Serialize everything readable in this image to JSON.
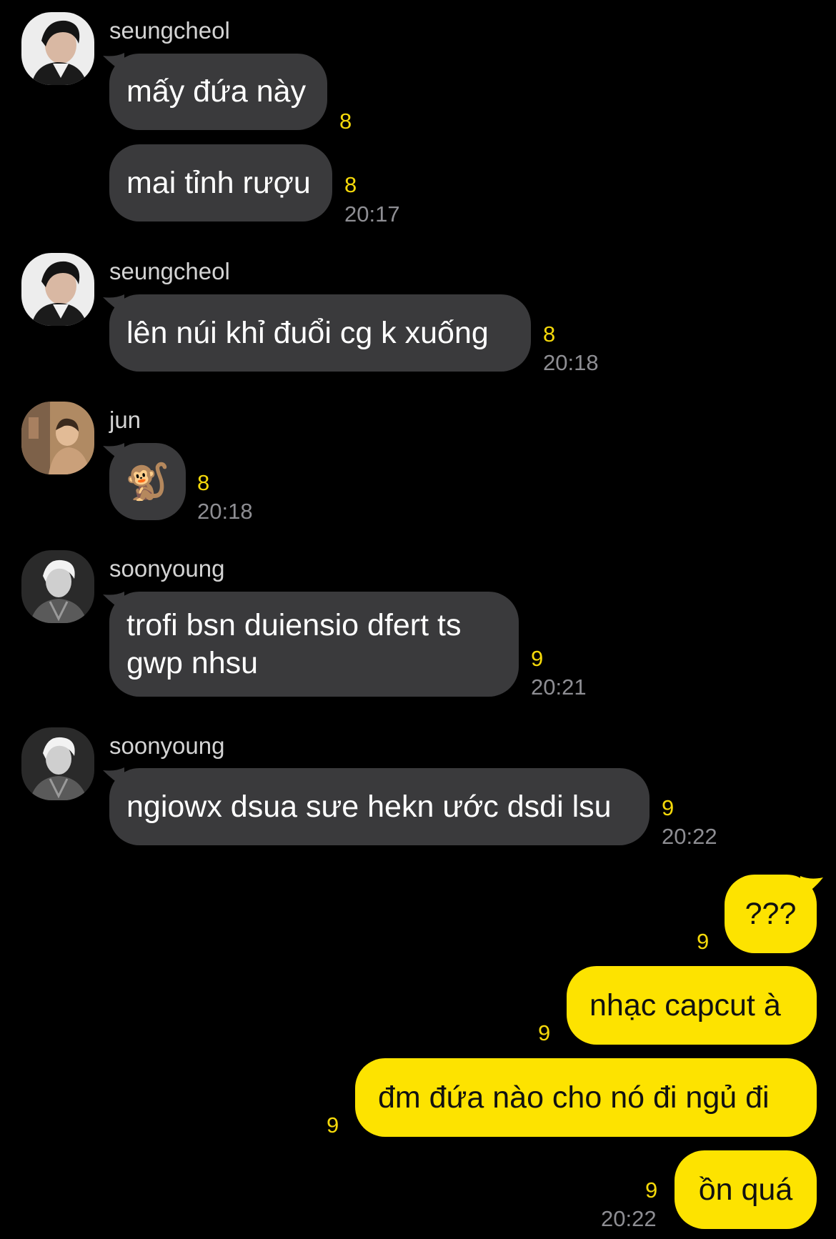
{
  "colors": {
    "background": "#000000",
    "incoming_bubble": "#3a3a3c",
    "outgoing_bubble": "#fde300",
    "unread_count": "#f5d90a",
    "timestamp": "#8e8e93"
  },
  "messages": [
    {
      "sender": "seungcheol",
      "bubbles": [
        {
          "text": "mấy đứa này",
          "unread": "8"
        },
        {
          "text": "mai tỉnh rượu",
          "unread": "8",
          "time": "20:17"
        }
      ]
    },
    {
      "sender": "seungcheol",
      "bubbles": [
        {
          "text": "lên núi khỉ đuổi cg k xuống",
          "unread": "8",
          "time": "20:18"
        }
      ]
    },
    {
      "sender": "jun",
      "bubbles": [
        {
          "text": "🐒",
          "unread": "8",
          "time": "20:18"
        }
      ]
    },
    {
      "sender": "soonyoung",
      "bubbles": [
        {
          "text": "trofi bsn duiensio dfert ts gwp nhsu",
          "unread": "9",
          "time": "20:21"
        }
      ]
    },
    {
      "sender": "soonyoung",
      "bubbles": [
        {
          "text": "ngiowx dsua sưe hekn ước dsdi lsu",
          "unread": "9",
          "time": "20:22"
        }
      ]
    }
  ],
  "outgoing": [
    {
      "text": "???",
      "unread": "9"
    },
    {
      "text": "nhạc capcut à",
      "unread": "9"
    },
    {
      "text": "đm đứa nào cho nó đi ngủ đi",
      "unread": "9"
    },
    {
      "text": "ồn quá",
      "unread": "9",
      "time": "20:22"
    }
  ]
}
